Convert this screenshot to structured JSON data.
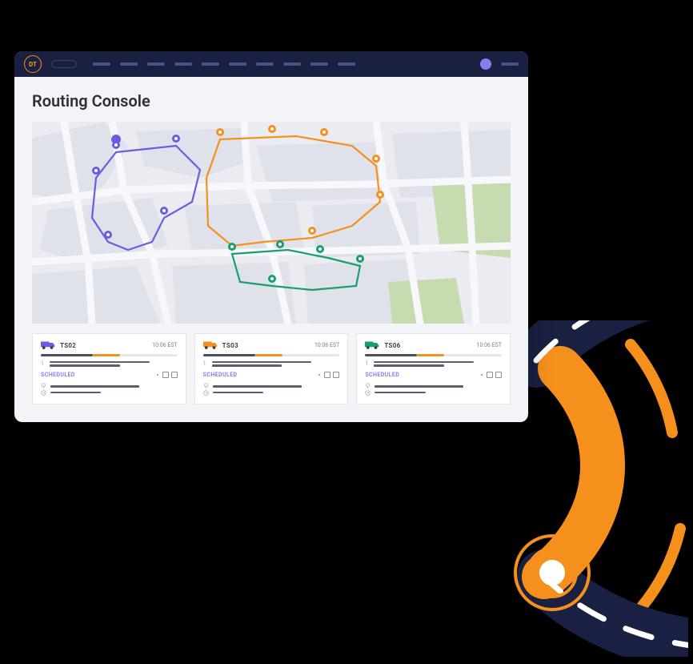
{
  "brand_initials": "DT",
  "page_title": "Routing Console",
  "colors": {
    "primary_navy": "#1a2042",
    "accent_orange": "#f5901d",
    "route_purple": "#6b5ce0",
    "route_orange": "#f5901d",
    "route_green": "#1a9e6b",
    "status_purple": "#8a7cf0"
  },
  "map": {
    "routes": [
      {
        "id": "purple",
        "color": "#6b5ce0",
        "stops": 5
      },
      {
        "id": "orange",
        "color": "#f5901d",
        "stops": 6
      },
      {
        "id": "green",
        "color": "#1a9e6b",
        "stops": 5
      }
    ]
  },
  "cards": [
    {
      "id": "TS02",
      "time": "10:06 EST",
      "truck_color": "#6b5ce0",
      "progress_dark": 38,
      "progress_orange_start": 38,
      "progress_orange_end": 58,
      "status": "SCHEDULED"
    },
    {
      "id": "TS03",
      "time": "10:06 EST",
      "truck_color": "#f5901d",
      "progress_dark": 38,
      "progress_orange_start": 38,
      "progress_orange_end": 58,
      "status": "SCHEDULED"
    },
    {
      "id": "TS06",
      "time": "10:06 EST",
      "truck_color": "#1a9e6b",
      "progress_dark": 38,
      "progress_orange_start": 38,
      "progress_orange_end": 58,
      "status": "SCHEDULED"
    }
  ]
}
